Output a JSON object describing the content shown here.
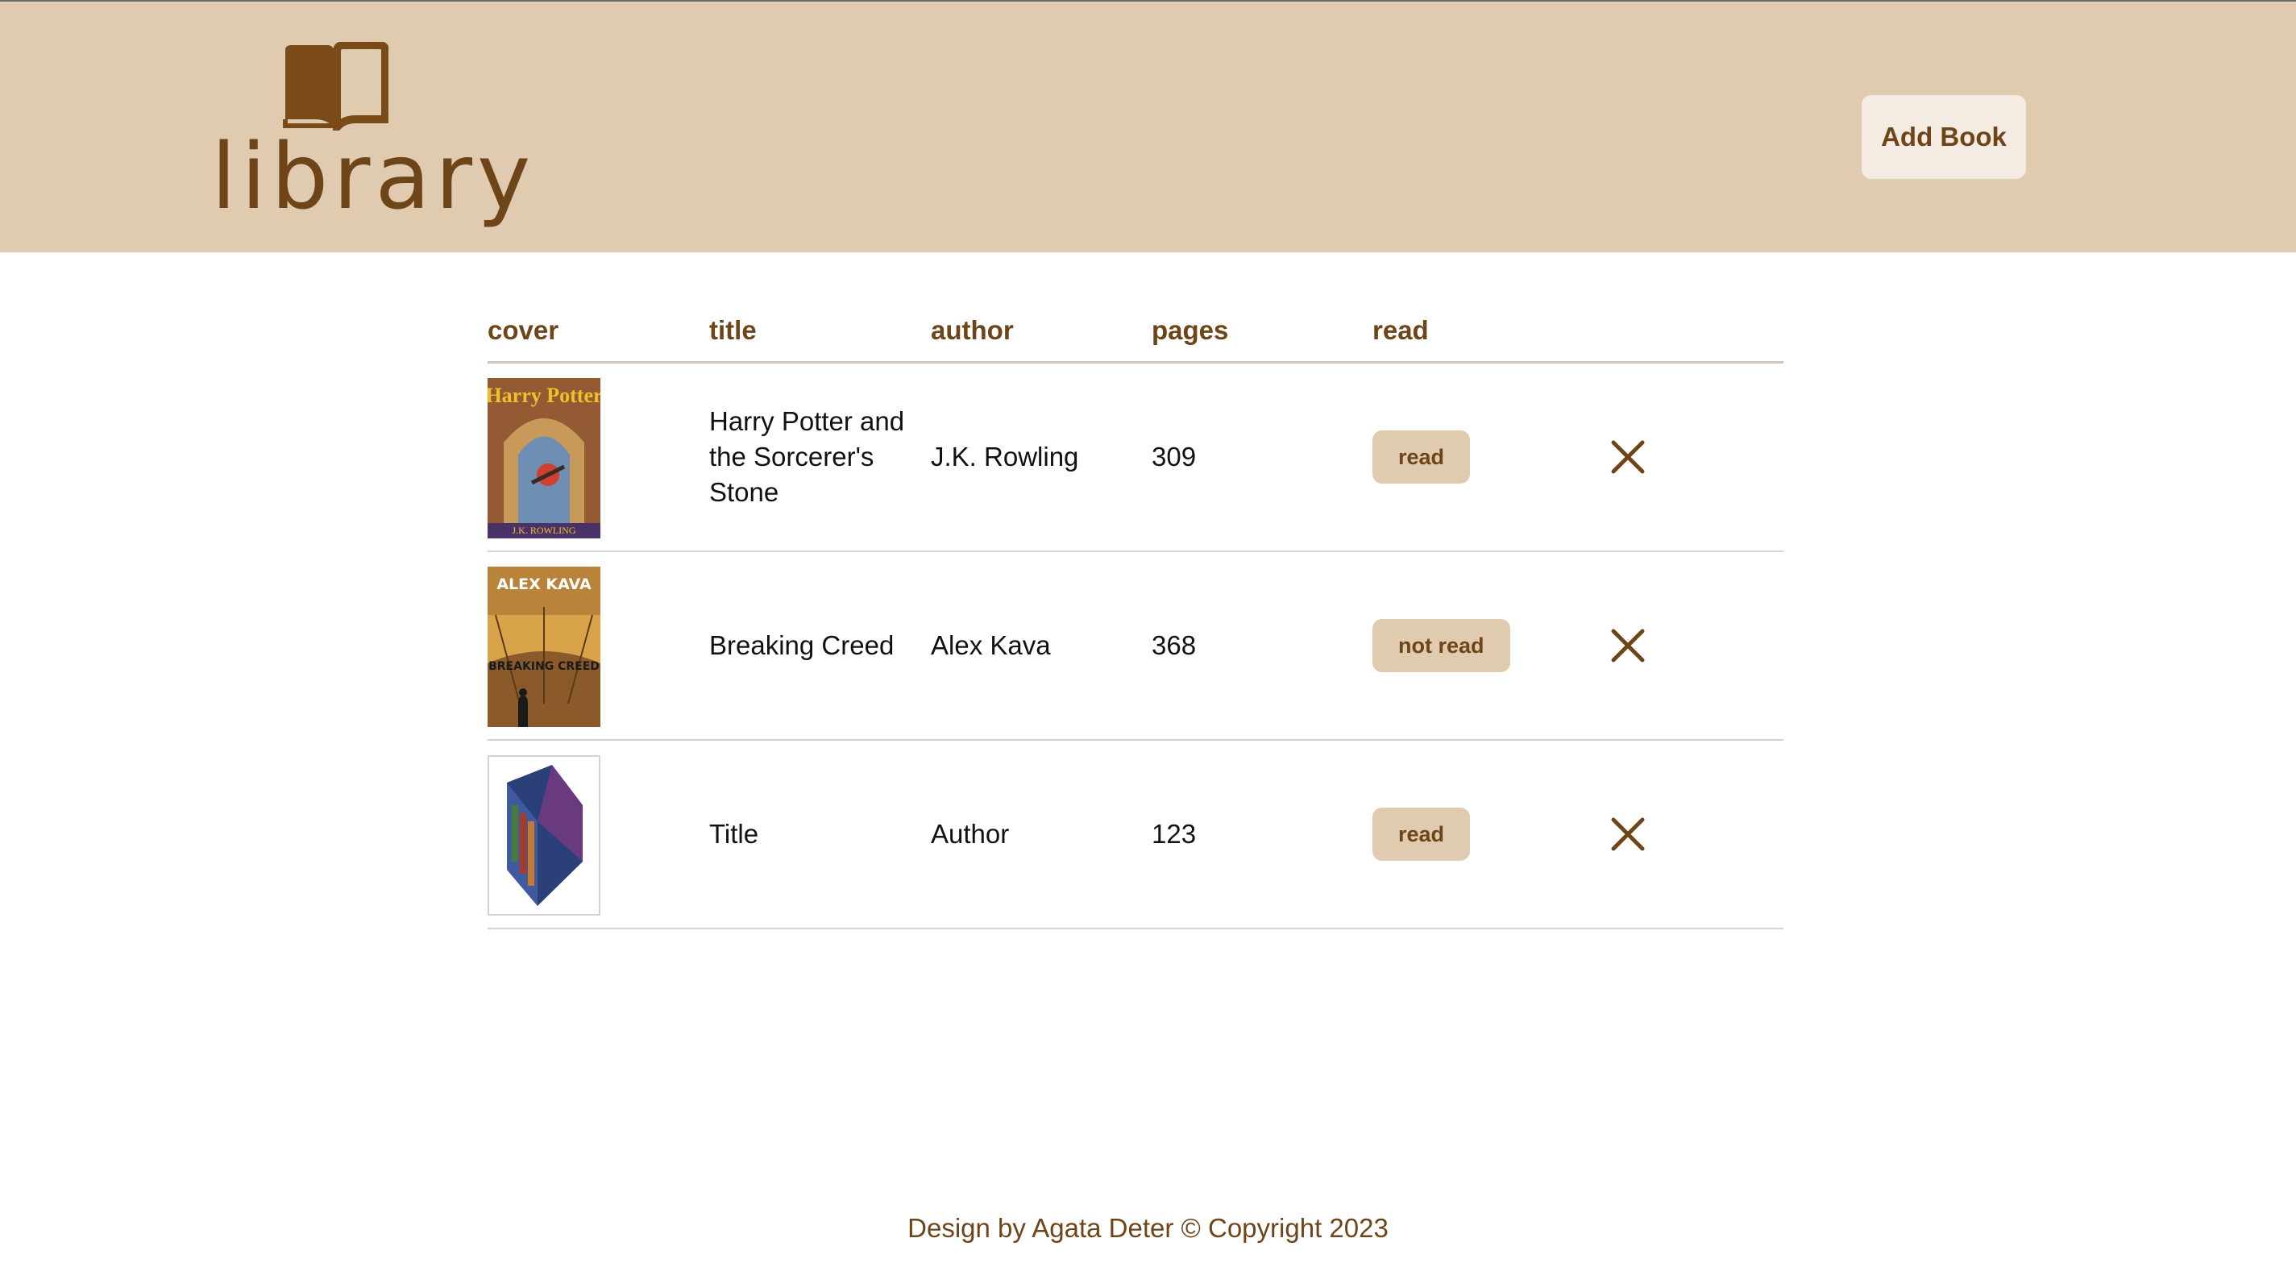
{
  "header": {
    "logo_text": "library",
    "add_button_label": "Add Book"
  },
  "table": {
    "columns": [
      "cover",
      "title",
      "author",
      "pages",
      "read"
    ],
    "rows": [
      {
        "title": "Harry Potter and the Sorcerer's Stone",
        "author": "J.K. Rowling",
        "pages": "309",
        "status": "read"
      },
      {
        "title": "Breaking Creed",
        "author": "Alex Kava",
        "pages": "368",
        "status": "not read"
      },
      {
        "title": "Title",
        "author": "Author",
        "pages": "123",
        "status": "read"
      }
    ]
  },
  "covers": {
    "cover1_text_top": "Harry Potter",
    "cover1_text_bottom": "J.K. ROWLING",
    "cover2_text_top": "ALEX KAVA",
    "cover2_text_bottom": "BREAKING CREED"
  },
  "footer": {
    "text": "Design by Agata Deter © Copyright 2023"
  },
  "colors": {
    "header_bg": "#e0cbb0",
    "accent": "#6d4518",
    "button_light": "#f4ebe2"
  }
}
